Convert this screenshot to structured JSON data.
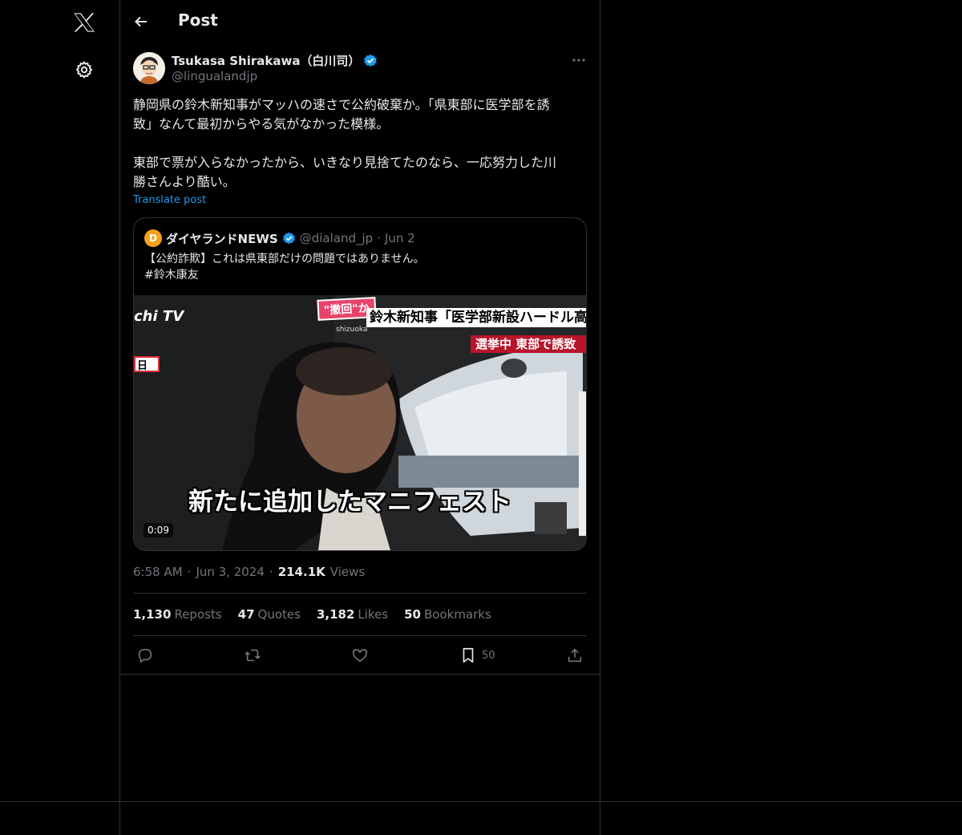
{
  "nav": {
    "logo_icon": "x-logo-icon",
    "settings_icon": "gear-icon"
  },
  "header": {
    "back_icon": "arrow-left-icon",
    "title": "Post"
  },
  "post": {
    "author_name": "Tsukasa Shirakawa（白川司）",
    "handle": "@lingualandjp",
    "verified_icon": "verified-badge-icon",
    "more_icon": "more-horizontal-icon",
    "text_lines": [
      "静岡県の鈴木新知事がマッハの速さで公約破棄か。「県東部に医学部を誘",
      "致」なんて最初からやる気がなかった模様。",
      "東部で票が入らなかったから、いきなり見捨てたのなら、一応努力した川",
      "勝さんより酷い。"
    ],
    "translate_label": "Translate post",
    "time": "6:58 AM",
    "date": "Jun 3, 2024",
    "views_count": "214.1K",
    "views_label": "Views",
    "separator": "·"
  },
  "quote": {
    "logo_letter": "D",
    "name": "ダイヤランドNEWS",
    "handle": "@dialand_jp",
    "date": "Jun 2",
    "text_line1": "【公約詐欺】これは県東部だけの問題ではありません。",
    "text_line2": "#鈴木康友",
    "video": {
      "duration": "0:09",
      "caption": "新たに追加したマニフェスト",
      "station": "chi TV",
      "banner_tag": "\"撤回\"か",
      "banner_location": "shizuoka",
      "banner_main": "鈴木新知事「医学部新設ハードル高",
      "banner_sub": "選挙中 東部で誘致",
      "left_tag": "日"
    }
  },
  "stats": {
    "reposts_count": "1,130",
    "reposts_label": "Reposts",
    "quotes_count": "47",
    "quotes_label": "Quotes",
    "likes_count": "3,182",
    "likes_label": "Likes",
    "bookmarks_count": "50",
    "bookmarks_label": "Bookmarks"
  },
  "actions": {
    "reply_icon": "reply-icon",
    "repost_icon": "repost-icon",
    "like_icon": "heart-icon",
    "bookmark_icon": "bookmark-icon",
    "bookmark_count": "50",
    "share_icon": "share-icon"
  },
  "colors": {
    "background": "#000000",
    "text": "#e7e9ea",
    "muted": "#71767b",
    "accent": "#1d9bf0",
    "border": "#2f3336"
  }
}
